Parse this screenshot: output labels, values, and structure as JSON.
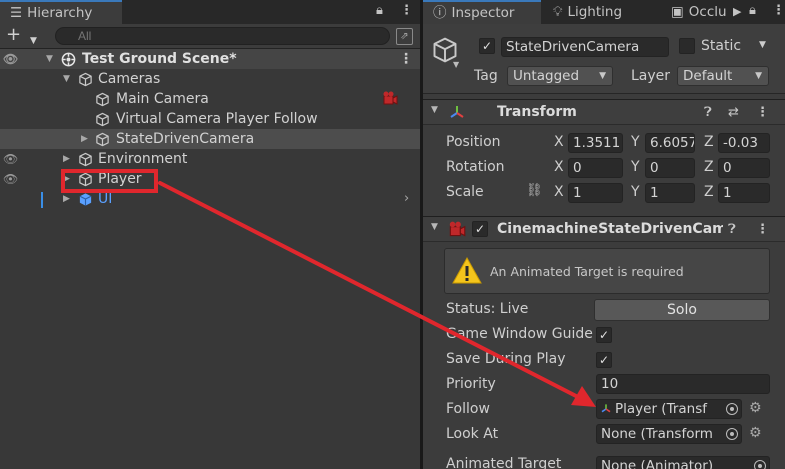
{
  "hierarchy": {
    "tab_label": "Hierarchy",
    "tab_glyph": "☰",
    "search_placeholder": "All",
    "rows": [
      {
        "label": "Test Ground Scene*"
      },
      {
        "label": "Cameras"
      },
      {
        "label": "Main Camera"
      },
      {
        "label": "Virtual Camera Player Follow"
      },
      {
        "label": "StateDrivenCamera"
      },
      {
        "label": "Environment"
      },
      {
        "label": "Player"
      },
      {
        "label": "UI"
      }
    ]
  },
  "inspector": {
    "tabs": [
      "Inspector",
      "Lighting",
      "Occlu"
    ],
    "object_name": "StateDrivenCamera",
    "static_label": "Static",
    "tag_label": "Tag",
    "tag_value": "Untagged",
    "layer_label": "Layer",
    "layer_value": "Default",
    "transform": {
      "title": "Transform",
      "position_label": "Position",
      "rotation_label": "Rotation",
      "scale_label": "Scale",
      "axis_x": "X",
      "axis_y": "Y",
      "axis_z": "Z",
      "position": [
        "1.3511",
        "6.6057",
        "-0.03"
      ],
      "rotation": [
        "0",
        "0",
        "0"
      ],
      "scale": [
        "1",
        "1",
        "1"
      ]
    },
    "state_driven": {
      "title": "CinemachineStateDrivenCame",
      "warning": "An Animated Target is required",
      "status_label": "Status: Live",
      "solo_label": "Solo",
      "game_window_guides_label": "Game Window Guide",
      "save_during_play_label": "Save During Play",
      "priority_label": "Priority",
      "priority_value": "10",
      "follow_label": "Follow",
      "follow_value": "Player (Transf",
      "look_at_label": "Look At",
      "look_at_value": "None (Transform",
      "animated_target_label": "Animated Target",
      "animated_target_value": "None (Animator)"
    }
  },
  "colors": {
    "annotation_red": "#e0272d",
    "selection_blue": "#3a79bb",
    "ui_prefab_blue": "#5aa0ff"
  }
}
